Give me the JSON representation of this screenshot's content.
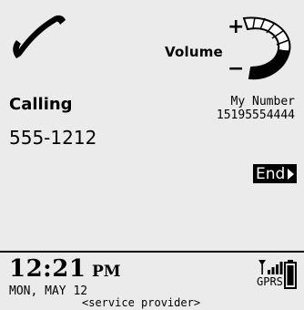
{
  "call": {
    "status_label": "Calling",
    "number": "555-1212",
    "my_number_label": "My Number",
    "my_number": "15195554444"
  },
  "volume": {
    "label": "Volume",
    "plus": "+",
    "minus": "−",
    "icon": "volume-dial-icon"
  },
  "actions": {
    "end_label": "End"
  },
  "status_bar": {
    "time": "12:21",
    "ampm": "PM",
    "date": "MON, MAY 12",
    "service_provider": "<service provider>",
    "network_type": "GPRS",
    "signal_icon": "signal-strength-icon",
    "battery_icon": "battery-icon"
  },
  "icons": {
    "phone": "phone-handset-icon"
  },
  "colors": {
    "background": "#ebebeb",
    "foreground": "#000000",
    "button_text": "#ffffff"
  }
}
